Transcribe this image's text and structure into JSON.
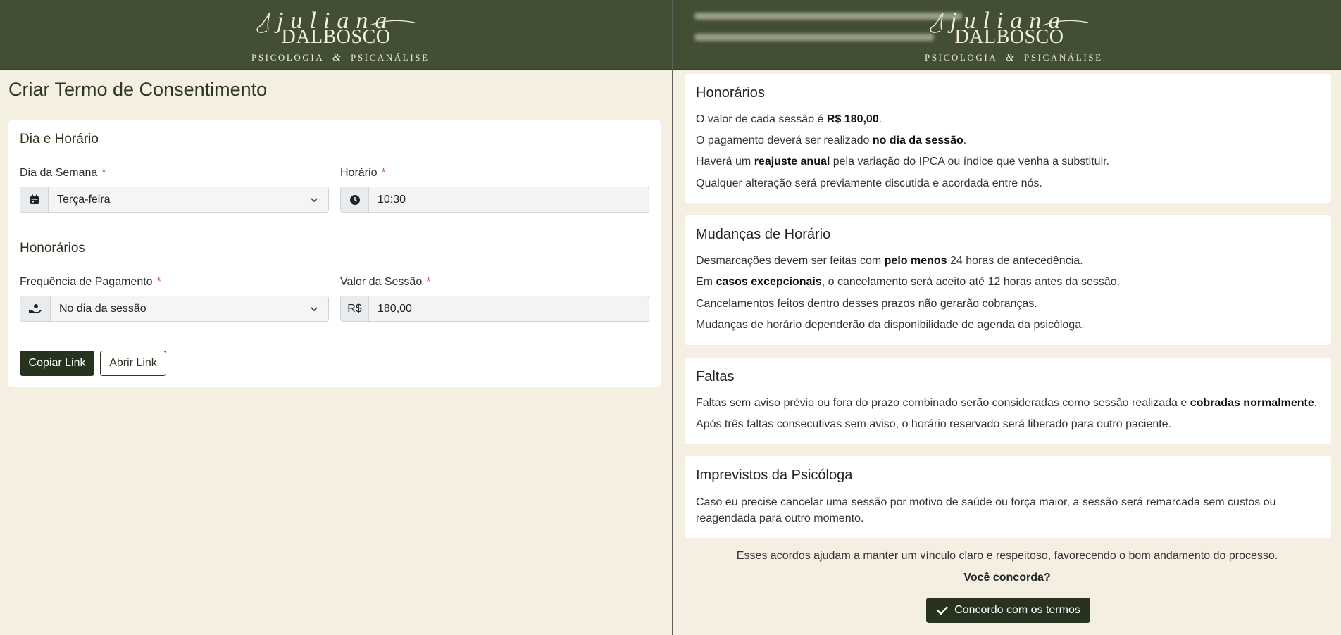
{
  "brand": {
    "script_name": "juliana",
    "surname": "DALBOSCO",
    "subtitle_left": "PSICOLOGIA",
    "subtitle_amp": "&",
    "subtitle_right": "PSICANÁLISE"
  },
  "colors": {
    "header_bg": "#424f35",
    "page_bg": "#f5efe1",
    "primary_button": "#28331f",
    "required": "#dc3545"
  },
  "form": {
    "title": "Criar Termo de Consentimento",
    "sections": {
      "schedule": "Dia e Horário",
      "fees": "Honorários"
    },
    "weekday": {
      "label": "Dia da Semana",
      "required": "*",
      "value": "Terça-feira",
      "icon": "calendar-icon"
    },
    "time": {
      "label": "Horário",
      "required": "*",
      "value": "10:30",
      "icon": "clock-icon"
    },
    "payment_frequency": {
      "label": "Frequência de Pagamento",
      "required": "*",
      "value": "No dia da sessão",
      "icon": "hand-coin-icon"
    },
    "session_value": {
      "label": "Valor da Sessão",
      "required": "*",
      "prefix": "R$",
      "value": "180,00"
    },
    "buttons": {
      "copy": "Copiar Link",
      "open": "Abrir Link"
    }
  },
  "terms": {
    "fees": {
      "title": "Honorários",
      "line1": {
        "pre": "O valor de cada sessão é ",
        "bold": "R$ 180,00",
        "post": "."
      },
      "line2": {
        "pre": "O pagamento deverá ser realizado ",
        "bold": "no dia da sessão",
        "post": "."
      },
      "line3": {
        "pre": "Haverá um ",
        "bold": "reajuste anual",
        "post": " pela variação do IPCA ou índice que venha a substituir."
      },
      "line4": "Qualquer alteração será previamente discutida e acordada entre nós."
    },
    "schedule_changes": {
      "title": "Mudanças de Horário",
      "line1": {
        "pre": "Desmarcações devem ser feitas com ",
        "bold": "pelo menos",
        "post": " 24 horas de antecedência."
      },
      "line2": {
        "pre": "Em ",
        "bold": "casos excepcionais",
        "post": ", o cancelamento será aceito até 12 horas antes da sessão."
      },
      "line3": "Cancelamentos feitos dentro desses prazos não gerarão cobranças.",
      "line4": "Mudanças de horário dependerão da disponibilidade de agenda da psicóloga."
    },
    "absences": {
      "title": "Faltas",
      "line1": {
        "pre": "Faltas sem aviso prévio ou fora do prazo combinado serão consideradas como sessão realizada e ",
        "bold": "cobradas normalmente",
        "post": "."
      },
      "line2": "Após três faltas consecutivas sem aviso, o horário reservado será liberado para outro paciente."
    },
    "unforeseen": {
      "title": "Imprevistos da Psicóloga",
      "text": "Caso eu precise cancelar uma sessão por motivo de saúde ou força maior, a sessão será remarcada sem custos ou reagendada para outro momento."
    },
    "closing": "Esses acordos ajudam a manter um vínculo claro e respeitoso, favorecendo o bom andamento do processo.",
    "question": "Você concorda?",
    "agree_button": "Concordo com os termos"
  }
}
